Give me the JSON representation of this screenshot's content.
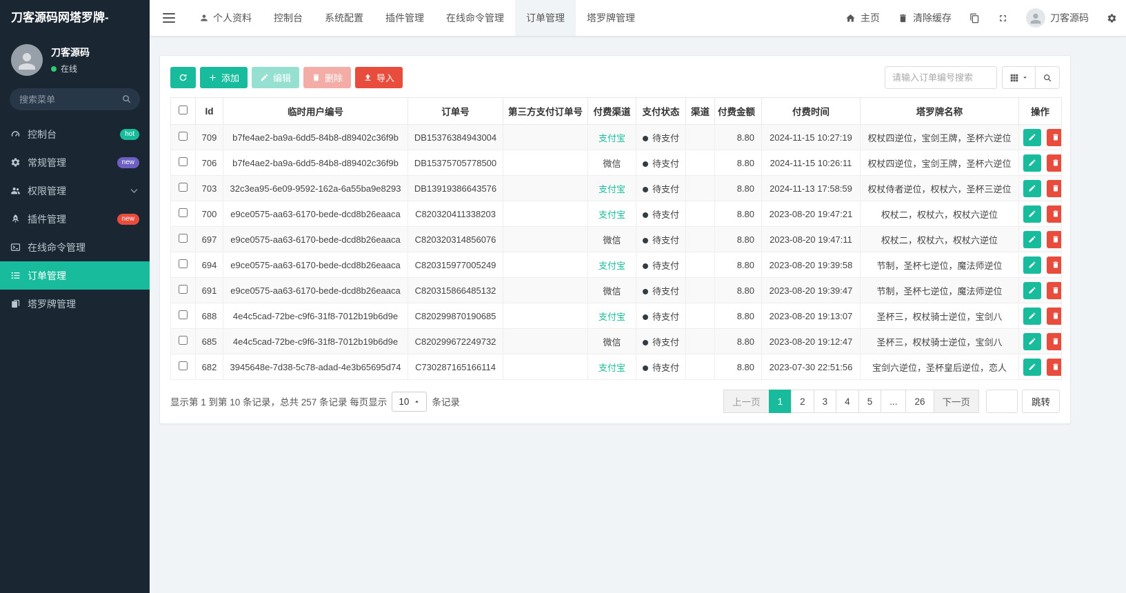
{
  "brand": {
    "title": "刀客源码网塔罗牌-"
  },
  "user_panel": {
    "name": "刀客源码",
    "status": "在线",
    "status_color": "#2ecc71"
  },
  "sidebar": {
    "search_placeholder": "搜索菜单",
    "items": [
      {
        "label": "控制台",
        "icon": "gauge-icon",
        "badge": "hot",
        "badge_color": "#18bc9c"
      },
      {
        "label": "常规管理",
        "icon": "gears-icon",
        "badge": "new",
        "badge_color": "#6d5fc3"
      },
      {
        "label": "权限管理",
        "icon": "users-icon"
      },
      {
        "label": "插件管理",
        "icon": "rocket-icon",
        "badge": "new",
        "badge_color": "#e74c3c"
      },
      {
        "label": "在线命令管理",
        "icon": "terminal-icon"
      },
      {
        "label": "订单管理",
        "icon": "list-icon",
        "active": true
      },
      {
        "label": "塔罗牌管理",
        "icon": "cards-icon"
      }
    ]
  },
  "topbar": {
    "nav": [
      "个人资料",
      "控制台",
      "系统配置",
      "插件管理",
      "在线命令管理",
      "订单管理",
      "塔罗牌管理"
    ],
    "active_nav": "订单管理",
    "home": "主页",
    "clear_cache": "清除缓存",
    "username": "刀客源码",
    "right_icons": [
      "home-icon",
      "trash-icon",
      "copy-icon",
      "fullscreen-icon",
      "avatar",
      "gear-icon"
    ]
  },
  "toolbar": {
    "refresh_icon": "refresh-icon",
    "add_label": "添加",
    "edit_label": "编辑",
    "delete_label": "删除",
    "import_label": "导入",
    "search_placeholder": "请输入订单编号搜索"
  },
  "table": {
    "columns": [
      "Id",
      "临时用户编号",
      "订单号",
      "第三方支付订单号",
      "付费渠道",
      "支付状态",
      "渠道",
      "付费金额",
      "付费时间",
      "塔罗牌名称",
      "操作"
    ],
    "colors": {
      "accent": "#18bc9c",
      "danger": "#e74c3c",
      "alipay": "#18bc9c",
      "status_dot": "#343c43"
    },
    "rows": [
      {
        "id": "709",
        "uid": "b7fe4ae2-ba9a-6dd5-84b8-d89402c36f9b",
        "order_no": "DB15376384943004",
        "third_no": "",
        "channel": "支付宝",
        "status": "待支付",
        "qudao": "",
        "amount": "8.80",
        "pay_time": "2024-11-15 10:27:19",
        "tarot": "权杖四逆位，宝剑王牌，圣杯六逆位"
      },
      {
        "id": "706",
        "uid": "b7fe4ae2-ba9a-6dd5-84b8-d89402c36f9b",
        "order_no": "DB15375705778500",
        "third_no": "",
        "channel": "微信",
        "status": "待支付",
        "qudao": "",
        "amount": "8.80",
        "pay_time": "2024-11-15 10:26:11",
        "tarot": "权杖四逆位，宝剑王牌，圣杯六逆位"
      },
      {
        "id": "703",
        "uid": "32c3ea95-6e09-9592-162a-6a55ba9e8293",
        "order_no": "DB13919386643576",
        "third_no": "",
        "channel": "支付宝",
        "status": "待支付",
        "qudao": "",
        "amount": "8.80",
        "pay_time": "2024-11-13 17:58:59",
        "tarot": "权杖侍者逆位，权杖六，圣杯三逆位"
      },
      {
        "id": "700",
        "uid": "e9ce0575-aa63-6170-bede-dcd8b26eaaca",
        "order_no": "C820320411338203",
        "third_no": "",
        "channel": "支付宝",
        "status": "待支付",
        "qudao": "",
        "amount": "8.80",
        "pay_time": "2023-08-20 19:47:21",
        "tarot": "权杖二，权杖六，权杖六逆位"
      },
      {
        "id": "697",
        "uid": "e9ce0575-aa63-6170-bede-dcd8b26eaaca",
        "order_no": "C820320314856076",
        "third_no": "",
        "channel": "微信",
        "status": "待支付",
        "qudao": "",
        "amount": "8.80",
        "pay_time": "2023-08-20 19:47:11",
        "tarot": "权杖二，权杖六，权杖六逆位"
      },
      {
        "id": "694",
        "uid": "e9ce0575-aa63-6170-bede-dcd8b26eaaca",
        "order_no": "C820315977005249",
        "third_no": "",
        "channel": "支付宝",
        "status": "待支付",
        "qudao": "",
        "amount": "8.80",
        "pay_time": "2023-08-20 19:39:58",
        "tarot": "节制，圣杯七逆位，魔法师逆位"
      },
      {
        "id": "691",
        "uid": "e9ce0575-aa63-6170-bede-dcd8b26eaaca",
        "order_no": "C820315866485132",
        "third_no": "",
        "channel": "微信",
        "status": "待支付",
        "qudao": "",
        "amount": "8.80",
        "pay_time": "2023-08-20 19:39:47",
        "tarot": "节制，圣杯七逆位，魔法师逆位"
      },
      {
        "id": "688",
        "uid": "4e4c5cad-72be-c9f6-31f8-7012b19b6d9e",
        "order_no": "C820299870190685",
        "third_no": "",
        "channel": "支付宝",
        "status": "待支付",
        "qudao": "",
        "amount": "8.80",
        "pay_time": "2023-08-20 19:13:07",
        "tarot": "圣杯三，权杖骑士逆位，宝剑八"
      },
      {
        "id": "685",
        "uid": "4e4c5cad-72be-c9f6-31f8-7012b19b6d9e",
        "order_no": "C820299672249732",
        "third_no": "",
        "channel": "微信",
        "status": "待支付",
        "qudao": "",
        "amount": "8.80",
        "pay_time": "2023-08-20 19:12:47",
        "tarot": "圣杯三，权杖骑士逆位，宝剑八"
      },
      {
        "id": "682",
        "uid": "3945648e-7d38-5c78-adad-4e3b65695d74",
        "order_no": "C730287165166114",
        "third_no": "",
        "channel": "支付宝",
        "status": "待支付",
        "qudao": "",
        "amount": "8.80",
        "pay_time": "2023-07-30 22:51:56",
        "tarot": "宝剑六逆位，圣杯皇后逆位，恋人"
      }
    ]
  },
  "footer": {
    "summary_prefix": "显示第 1 到第 10 条记录，总共 257 条记录 每页显示",
    "page_size": "10",
    "summary_suffix": "条记录",
    "prev": "上一页",
    "next": "下一页",
    "pages": [
      "1",
      "2",
      "3",
      "4",
      "5",
      "...",
      "26"
    ],
    "active_page": "1",
    "jump_label": "跳转"
  }
}
